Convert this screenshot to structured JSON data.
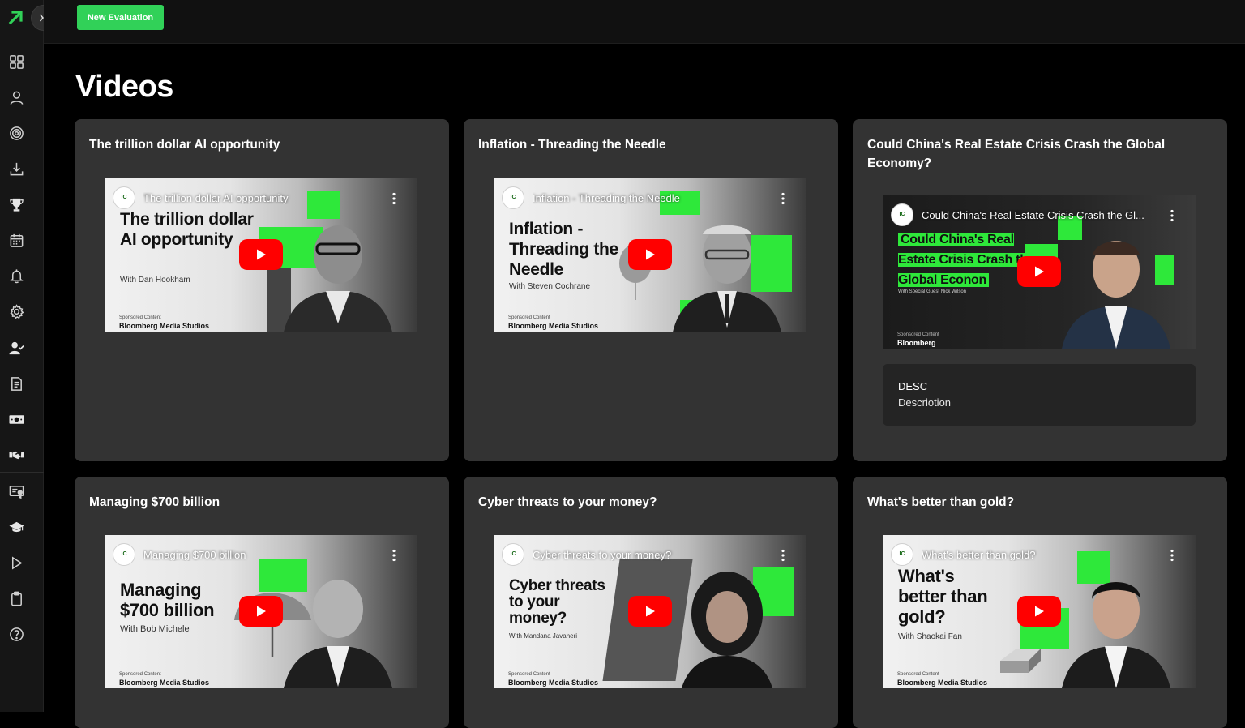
{
  "colors": {
    "accent": "#31d158",
    "card": "#333333",
    "youtube_red": "#ff0000"
  },
  "toolbar": {
    "new_evaluation_label": "New Evaluation"
  },
  "page": {
    "title": "Videos"
  },
  "sidebar": {
    "icons": [
      "dashboard-icon",
      "user-icon",
      "target-icon",
      "download-icon",
      "trophy-icon",
      "calendar-icon",
      "bell-icon",
      "settings-icon",
      "user-check-icon",
      "document-icon",
      "money-icon",
      "handshake-icon",
      "certificate-icon",
      "graduation-cap-icon",
      "play-icon",
      "clipboard-icon",
      "help-icon"
    ]
  },
  "videos": [
    {
      "title": "The trillion dollar AI opportunity",
      "overlay_title": "The trillion dollar AI opportunity",
      "headline": "The trillion dollar AI opportunity",
      "byline": "With Dan Hookham",
      "sponsor": "Sponsored Content",
      "brand": "Bloomberg Media Studios"
    },
    {
      "title": "Inflation - Threading the Needle",
      "overlay_title": "Inflation - Threading the Needle",
      "headline": "Inflation - Threading the Needle",
      "byline": "With Steven Cochrane",
      "sponsor": "Sponsored Content",
      "brand": "Bloomberg Media Studios"
    },
    {
      "title": "Could China's Real Estate Crisis Crash the Global Economy?",
      "overlay_title": "Could China's Real Estate Crisis Crash the Gl...",
      "headline": "Could China's Real Estate Crisis Crash the Global Econon",
      "byline": "With Special Guest Nick Wilson",
      "sponsor": "Sponsored Content",
      "brand": "Bloomberg",
      "desc_label": "DESC",
      "desc_text": "Descriotion"
    },
    {
      "title": "Managing $700 billion",
      "overlay_title": "Managing $700 billion",
      "headline": "Managing $700 billion",
      "byline": "With Bob Michele",
      "sponsor": "Sponsored Content",
      "brand": "Bloomberg Media Studios"
    },
    {
      "title": "Cyber threats to your money?",
      "overlay_title": "Cyber threats to your money?",
      "headline": "Cyber threats to your money?",
      "byline": "With Mandana Javaheri",
      "sponsor": "Sponsored Content",
      "brand": "Bloomberg Media Studios"
    },
    {
      "title": "What's better than gold?",
      "overlay_title": "What's better than gold?",
      "headline": "What's better than gold?",
      "byline": "With Shaokai Fan",
      "sponsor": "Sponsored Content",
      "brand": "Bloomberg Media Studios"
    }
  ]
}
